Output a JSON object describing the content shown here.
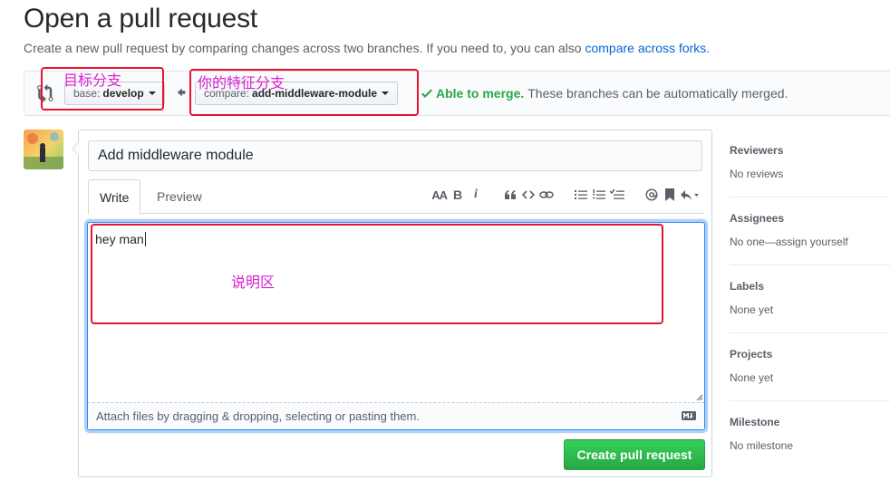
{
  "page": {
    "title": "Open a pull request",
    "subtitle": "Create a new pull request by comparing changes across two branches. If you need to, you can also ",
    "subtitle_link": "compare across forks",
    "subtitle_end": "."
  },
  "range": {
    "base_prefix": "base:",
    "base_branch": "develop",
    "compare_prefix": "compare:",
    "compare_branch": "add-middleware-module",
    "merge_ok": "Able to merge.",
    "merge_text": "These branches can be automatically merged."
  },
  "annotations": {
    "base_note": "目标分支",
    "compare_note": "你的特征分支",
    "body_note": "说明区"
  },
  "composer": {
    "title_value": "Add middleware module",
    "tab_write": "Write",
    "tab_preview": "Preview",
    "body_text": "hey man",
    "drop_hint": "Attach files by dragging & dropping, selecting or pasting them.",
    "submit_label": "Create pull request"
  },
  "toolbar": {
    "header": "AA",
    "bold": "B",
    "italic": "i"
  },
  "sidebar": {
    "reviewers": {
      "heading": "Reviewers",
      "value": "No reviews"
    },
    "assignees": {
      "heading": "Assignees",
      "value": "No one—assign yourself"
    },
    "labels": {
      "heading": "Labels",
      "value": "None yet"
    },
    "projects": {
      "heading": "Projects",
      "value": "None yet"
    },
    "milestone": {
      "heading": "Milestone",
      "value": "No milestone"
    }
  },
  "colors": {
    "accent_green": "#28a745",
    "link_blue": "#0366d6",
    "annotation_red": "#e8142f",
    "annotation_magenta": "#d91fd2"
  }
}
